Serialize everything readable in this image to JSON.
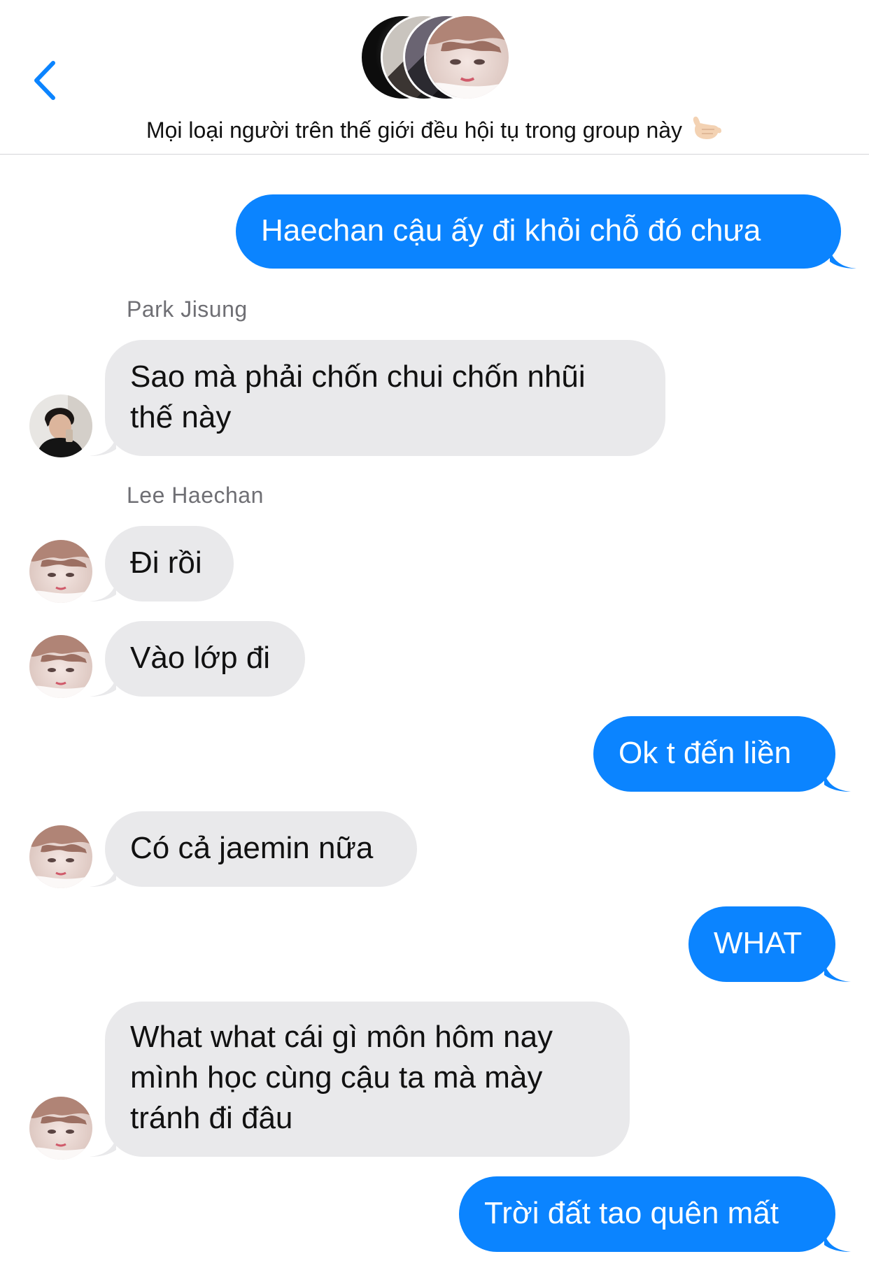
{
  "header": {
    "title": "Mọi loại người trên thế giới đều hội tụ trong group này",
    "back_icon": "chevron-left-icon",
    "emoji": "call-me-hand-emoji"
  },
  "colors": {
    "outgoing_bubble": "#0b84ff",
    "incoming_bubble": "#e9e9eb",
    "accent": "#0b84ff"
  },
  "messages": [
    {
      "direction": "outgoing",
      "text": "Haechan cậu ấy đi khỏi chỗ đó chưa"
    },
    {
      "direction": "incoming",
      "sender": "Park Jisung",
      "lines": [
        "Sao mà phải chốn chui chốn nhũi",
        "thế này"
      ]
    },
    {
      "direction": "incoming",
      "sender": "Lee Haechan",
      "text": "Đi rồi"
    },
    {
      "direction": "incoming",
      "text": "Vào lớp đi"
    },
    {
      "direction": "outgoing",
      "text": "Ok t đến liền"
    },
    {
      "direction": "incoming",
      "text": "Có cả jaemin nữa"
    },
    {
      "direction": "outgoing",
      "text": "WHAT"
    },
    {
      "direction": "incoming",
      "lines": [
        "What what cái gì môn hôm nay",
        "mình học cùng cậu ta mà mày",
        "tránh đi đâu"
      ]
    },
    {
      "direction": "outgoing",
      "text": "Trời đất tao quên mất"
    }
  ]
}
